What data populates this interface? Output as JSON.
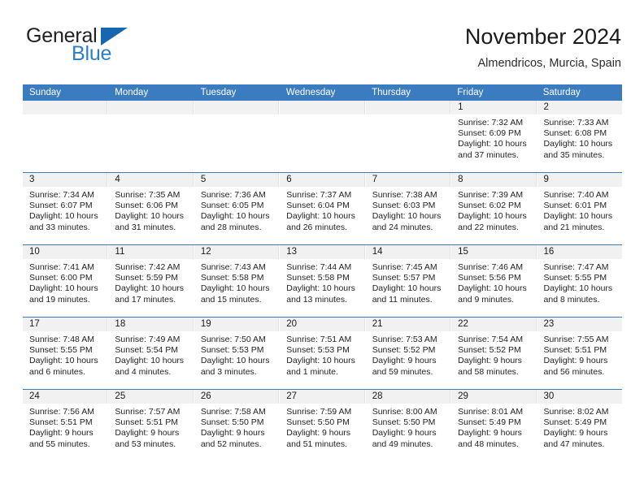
{
  "brand": {
    "name_part1": "General",
    "name_part2": "Blue",
    "triangle_icon": "triangle-icon",
    "accent_color": "#2b7fc4"
  },
  "header": {
    "title": "November 2024",
    "location": "Almendricos, Murcia, Spain"
  },
  "calendar": {
    "header_color": "#3b7cc0",
    "daynum_band_color": "#f1f1f1",
    "weekdays": [
      "Sunday",
      "Monday",
      "Tuesday",
      "Wednesday",
      "Thursday",
      "Friday",
      "Saturday"
    ],
    "weeks": [
      [
        {
          "day": "",
          "empty": true
        },
        {
          "day": "",
          "empty": true
        },
        {
          "day": "",
          "empty": true
        },
        {
          "day": "",
          "empty": true
        },
        {
          "day": "",
          "empty": true
        },
        {
          "day": "1",
          "sunrise": "Sunrise: 7:32 AM",
          "sunset": "Sunset: 6:09 PM",
          "daylight1": "Daylight: 10 hours",
          "daylight2": "and 37 minutes."
        },
        {
          "day": "2",
          "sunrise": "Sunrise: 7:33 AM",
          "sunset": "Sunset: 6:08 PM",
          "daylight1": "Daylight: 10 hours",
          "daylight2": "and 35 minutes."
        }
      ],
      [
        {
          "day": "3",
          "sunrise": "Sunrise: 7:34 AM",
          "sunset": "Sunset: 6:07 PM",
          "daylight1": "Daylight: 10 hours",
          "daylight2": "and 33 minutes."
        },
        {
          "day": "4",
          "sunrise": "Sunrise: 7:35 AM",
          "sunset": "Sunset: 6:06 PM",
          "daylight1": "Daylight: 10 hours",
          "daylight2": "and 31 minutes."
        },
        {
          "day": "5",
          "sunrise": "Sunrise: 7:36 AM",
          "sunset": "Sunset: 6:05 PM",
          "daylight1": "Daylight: 10 hours",
          "daylight2": "and 28 minutes."
        },
        {
          "day": "6",
          "sunrise": "Sunrise: 7:37 AM",
          "sunset": "Sunset: 6:04 PM",
          "daylight1": "Daylight: 10 hours",
          "daylight2": "and 26 minutes."
        },
        {
          "day": "7",
          "sunrise": "Sunrise: 7:38 AM",
          "sunset": "Sunset: 6:03 PM",
          "daylight1": "Daylight: 10 hours",
          "daylight2": "and 24 minutes."
        },
        {
          "day": "8",
          "sunrise": "Sunrise: 7:39 AM",
          "sunset": "Sunset: 6:02 PM",
          "daylight1": "Daylight: 10 hours",
          "daylight2": "and 22 minutes."
        },
        {
          "day": "9",
          "sunrise": "Sunrise: 7:40 AM",
          "sunset": "Sunset: 6:01 PM",
          "daylight1": "Daylight: 10 hours",
          "daylight2": "and 21 minutes."
        }
      ],
      [
        {
          "day": "10",
          "sunrise": "Sunrise: 7:41 AM",
          "sunset": "Sunset: 6:00 PM",
          "daylight1": "Daylight: 10 hours",
          "daylight2": "and 19 minutes."
        },
        {
          "day": "11",
          "sunrise": "Sunrise: 7:42 AM",
          "sunset": "Sunset: 5:59 PM",
          "daylight1": "Daylight: 10 hours",
          "daylight2": "and 17 minutes."
        },
        {
          "day": "12",
          "sunrise": "Sunrise: 7:43 AM",
          "sunset": "Sunset: 5:58 PM",
          "daylight1": "Daylight: 10 hours",
          "daylight2": "and 15 minutes."
        },
        {
          "day": "13",
          "sunrise": "Sunrise: 7:44 AM",
          "sunset": "Sunset: 5:58 PM",
          "daylight1": "Daylight: 10 hours",
          "daylight2": "and 13 minutes."
        },
        {
          "day": "14",
          "sunrise": "Sunrise: 7:45 AM",
          "sunset": "Sunset: 5:57 PM",
          "daylight1": "Daylight: 10 hours",
          "daylight2": "and 11 minutes."
        },
        {
          "day": "15",
          "sunrise": "Sunrise: 7:46 AM",
          "sunset": "Sunset: 5:56 PM",
          "daylight1": "Daylight: 10 hours",
          "daylight2": "and 9 minutes."
        },
        {
          "day": "16",
          "sunrise": "Sunrise: 7:47 AM",
          "sunset": "Sunset: 5:55 PM",
          "daylight1": "Daylight: 10 hours",
          "daylight2": "and 8 minutes."
        }
      ],
      [
        {
          "day": "17",
          "sunrise": "Sunrise: 7:48 AM",
          "sunset": "Sunset: 5:55 PM",
          "daylight1": "Daylight: 10 hours",
          "daylight2": "and 6 minutes."
        },
        {
          "day": "18",
          "sunrise": "Sunrise: 7:49 AM",
          "sunset": "Sunset: 5:54 PM",
          "daylight1": "Daylight: 10 hours",
          "daylight2": "and 4 minutes."
        },
        {
          "day": "19",
          "sunrise": "Sunrise: 7:50 AM",
          "sunset": "Sunset: 5:53 PM",
          "daylight1": "Daylight: 10 hours",
          "daylight2": "and 3 minutes."
        },
        {
          "day": "20",
          "sunrise": "Sunrise: 7:51 AM",
          "sunset": "Sunset: 5:53 PM",
          "daylight1": "Daylight: 10 hours",
          "daylight2": "and 1 minute."
        },
        {
          "day": "21",
          "sunrise": "Sunrise: 7:53 AM",
          "sunset": "Sunset: 5:52 PM",
          "daylight1": "Daylight: 9 hours",
          "daylight2": "and 59 minutes."
        },
        {
          "day": "22",
          "sunrise": "Sunrise: 7:54 AM",
          "sunset": "Sunset: 5:52 PM",
          "daylight1": "Daylight: 9 hours",
          "daylight2": "and 58 minutes."
        },
        {
          "day": "23",
          "sunrise": "Sunrise: 7:55 AM",
          "sunset": "Sunset: 5:51 PM",
          "daylight1": "Daylight: 9 hours",
          "daylight2": "and 56 minutes."
        }
      ],
      [
        {
          "day": "24",
          "sunrise": "Sunrise: 7:56 AM",
          "sunset": "Sunset: 5:51 PM",
          "daylight1": "Daylight: 9 hours",
          "daylight2": "and 55 minutes."
        },
        {
          "day": "25",
          "sunrise": "Sunrise: 7:57 AM",
          "sunset": "Sunset: 5:51 PM",
          "daylight1": "Daylight: 9 hours",
          "daylight2": "and 53 minutes."
        },
        {
          "day": "26",
          "sunrise": "Sunrise: 7:58 AM",
          "sunset": "Sunset: 5:50 PM",
          "daylight1": "Daylight: 9 hours",
          "daylight2": "and 52 minutes."
        },
        {
          "day": "27",
          "sunrise": "Sunrise: 7:59 AM",
          "sunset": "Sunset: 5:50 PM",
          "daylight1": "Daylight: 9 hours",
          "daylight2": "and 51 minutes."
        },
        {
          "day": "28",
          "sunrise": "Sunrise: 8:00 AM",
          "sunset": "Sunset: 5:50 PM",
          "daylight1": "Daylight: 9 hours",
          "daylight2": "and 49 minutes."
        },
        {
          "day": "29",
          "sunrise": "Sunrise: 8:01 AM",
          "sunset": "Sunset: 5:49 PM",
          "daylight1": "Daylight: 9 hours",
          "daylight2": "and 48 minutes."
        },
        {
          "day": "30",
          "sunrise": "Sunrise: 8:02 AM",
          "sunset": "Sunset: 5:49 PM",
          "daylight1": "Daylight: 9 hours",
          "daylight2": "and 47 minutes."
        }
      ]
    ]
  }
}
